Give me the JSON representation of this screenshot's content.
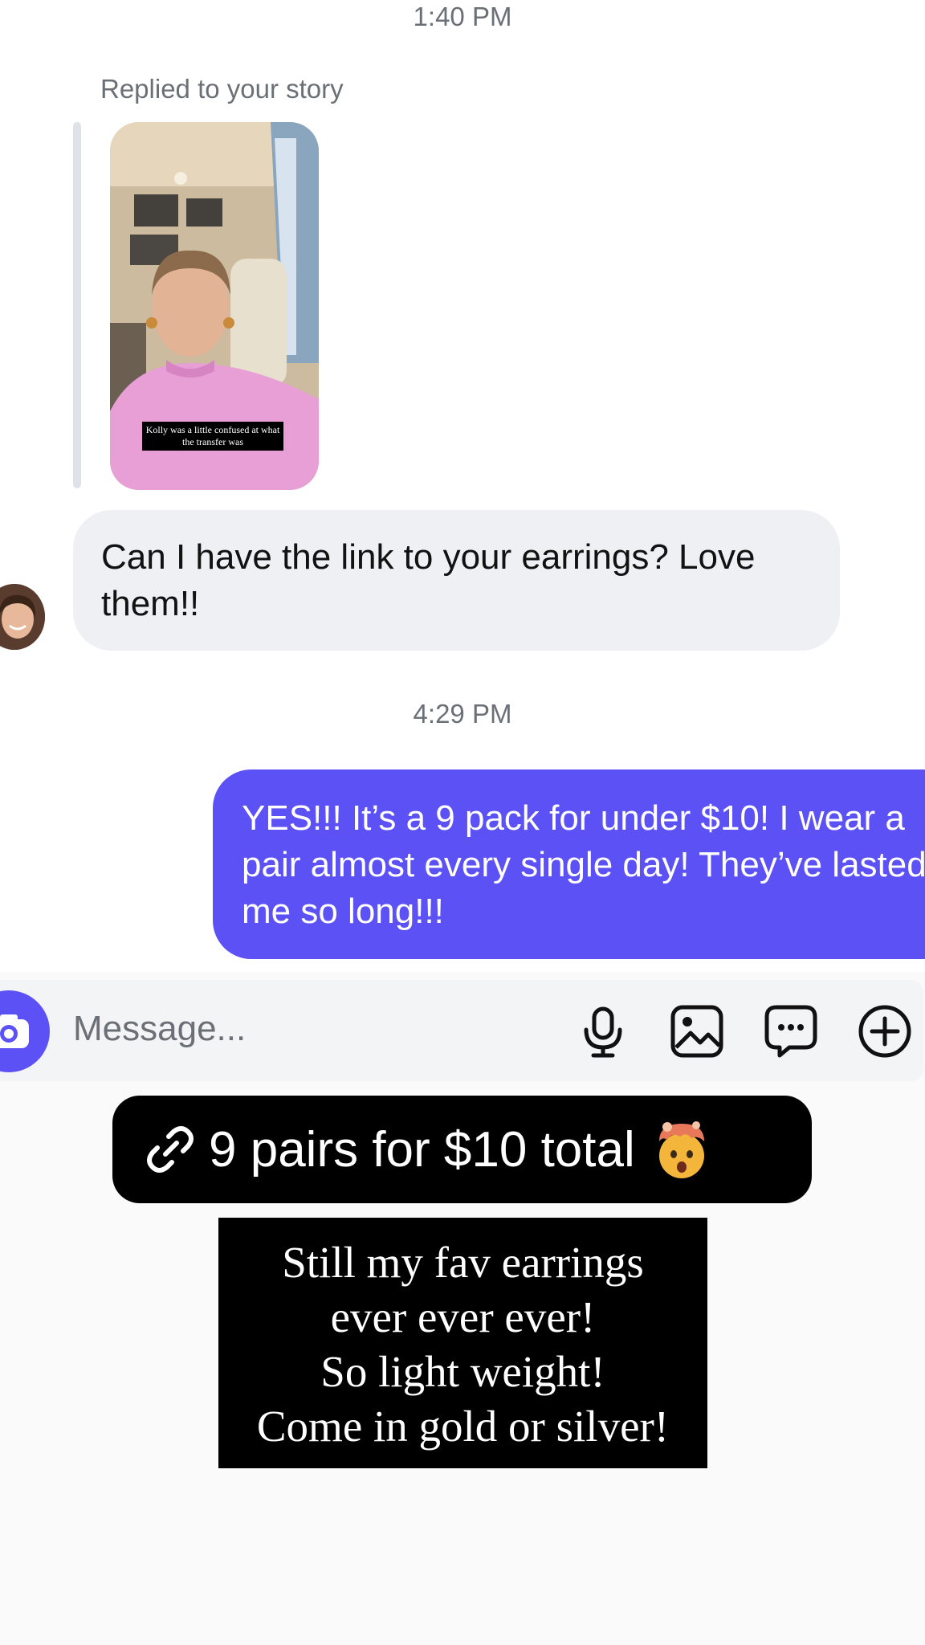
{
  "thread": {
    "timestamp_1": "1:40 PM",
    "reply_label": "Replied to your story",
    "story_caption": "Kolly was a little confused at what the transfer was",
    "incoming_message": "Can I have the link to your earrings? Love them!!",
    "timestamp_2": "4:29 PM",
    "outgoing_message": "YES!!! It’s a 9 pack for under $10! I wear a pair almost every single day! They’ve lasted me so long!!!"
  },
  "composer": {
    "placeholder": "Message...",
    "icons": [
      "camera-icon",
      "microphone-icon",
      "image-icon",
      "sticker-chat-icon",
      "plus-circle-icon"
    ]
  },
  "overlay": {
    "link_sticker_text": "9 pairs for $10 total",
    "link_sticker_emoji": "🤯",
    "text_sticker_lines": [
      "Still my fav earrings",
      "ever ever ever!",
      "So light weight!",
      "Come in gold or silver!"
    ]
  },
  "colors": {
    "accent": "#5b51f5",
    "incoming_bubble": "#eef0f3",
    "composer_bg": "#f3f4f6",
    "muted_text": "#6b6f76"
  }
}
